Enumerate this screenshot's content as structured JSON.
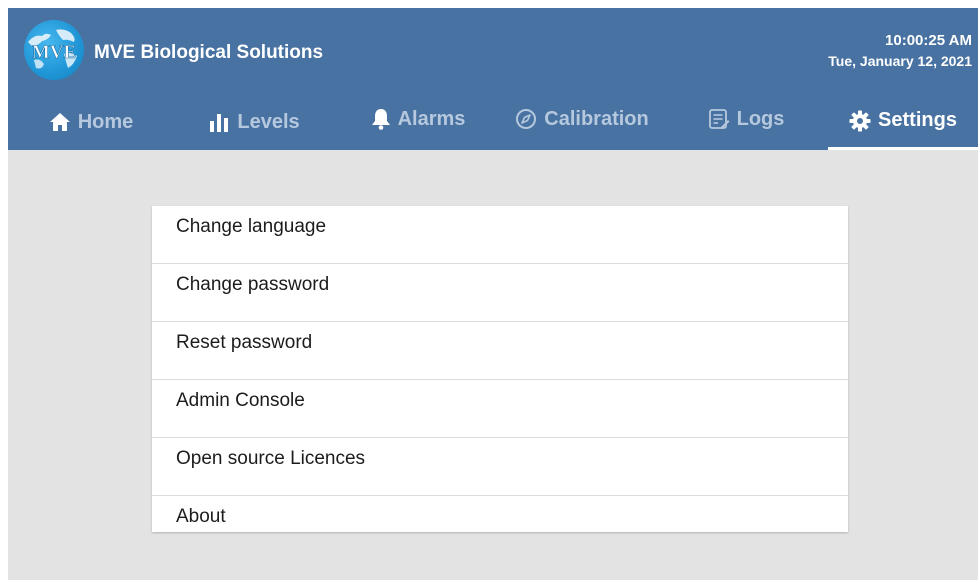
{
  "header": {
    "brand_name": "MVE Biological Solutions",
    "logo_text": "MVE",
    "time": "10:00:25 AM",
    "date": "Tue, January 12, 2021"
  },
  "nav": {
    "tabs": [
      {
        "label": "Home",
        "icon": "home-icon"
      },
      {
        "label": "Levels",
        "icon": "bar-chart-icon"
      },
      {
        "label": "Alarms",
        "icon": "bell-icon"
      },
      {
        "label": "Calibration",
        "icon": "compass-icon"
      },
      {
        "label": "Logs",
        "icon": "log-icon"
      },
      {
        "label": "Settings",
        "icon": "gear-icon"
      }
    ],
    "active_tab": "Settings"
  },
  "settings_menu": {
    "items": [
      {
        "label": "Change language"
      },
      {
        "label": "Change password"
      },
      {
        "label": "Reset password"
      },
      {
        "label": "Admin Console"
      },
      {
        "label": "Open source Licences"
      },
      {
        "label": "About"
      }
    ]
  },
  "colors": {
    "header_bg": "#4872a1",
    "inactive_tab": "#b6c8de",
    "active_tab": "#ffffff",
    "page_bg": "#e3e3e3",
    "card_bg": "#ffffff"
  }
}
